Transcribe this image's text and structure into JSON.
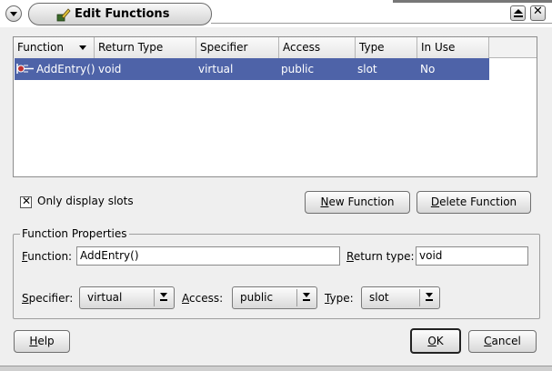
{
  "window": {
    "title": "Edit Functions"
  },
  "list": {
    "columns": [
      "Function",
      "Return Type",
      "Specifier",
      "Access",
      "Type",
      "In Use"
    ],
    "rows": [
      {
        "function": "AddEntry()",
        "return_type": "void",
        "specifier": "virtual",
        "access": "public",
        "type": "slot",
        "in_use": "No"
      }
    ]
  },
  "filter": {
    "checked": true,
    "label": "Only display slots"
  },
  "buttons": {
    "new_function": {
      "mnemonic": "N",
      "rest": "ew Function"
    },
    "delete_function": {
      "mnemonic": "D",
      "rest": "elete Function"
    },
    "help": {
      "mnemonic": "H",
      "rest": "elp"
    },
    "ok": {
      "mnemonic": "O",
      "rest": "K"
    },
    "cancel": {
      "mnemonic": "C",
      "rest": "ancel"
    }
  },
  "properties": {
    "group_title": "Function Properties",
    "function_label": {
      "mnemonic": "F",
      "rest": "unction:"
    },
    "function_value": "AddEntry()",
    "return_type_label": {
      "mnemonic": "R",
      "rest": "eturn type:"
    },
    "return_type_value": "void",
    "specifier_label": {
      "mnemonic": "S",
      "rest": "pecifier:"
    },
    "specifier_value": "virtual",
    "access_label": {
      "mnemonic": "A",
      "rest": "ccess:"
    },
    "access_value": "public",
    "type_label": {
      "mnemonic": "T",
      "rest": "ype:"
    },
    "type_value": "slot"
  },
  "colors": {
    "selection": "#4e63a8",
    "window_bg": "#efefef"
  },
  "icons": {
    "title": "function-edit-icon",
    "row": "slot-function-icon"
  }
}
